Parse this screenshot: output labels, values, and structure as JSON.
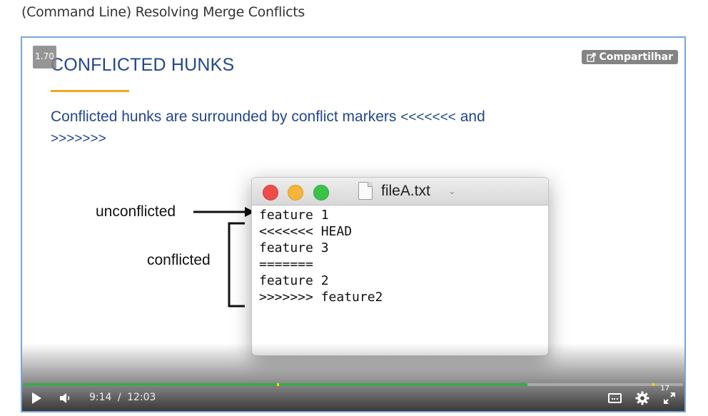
{
  "page": {
    "heading": "(Command Line) Resolving Merge Conflicts"
  },
  "player": {
    "speed": "1.70",
    "share_label": "Compartilhar",
    "current_time": "9:14",
    "time_separator": "/",
    "duration": "12:03",
    "progress_fraction": 0.764,
    "played_fraction": 0.0,
    "count_badge": "17",
    "accent_color": "#3da750",
    "chapter_marker_color": "#ffd500"
  },
  "slide": {
    "title": "CONFLICTED HUNKS",
    "text_main": "Conflicted hunks are surrounded by conflict markers ",
    "text_marker_open": "<<<<<<<",
    "text_and": " and",
    "text_marker_close": ">>>>>>>",
    "label_unconflicted": "unconflicted",
    "label_conflicted": "conflicted",
    "title_color": "#22468f",
    "underline_color": "#f0a81c"
  },
  "file_window": {
    "title": "fileA.txt",
    "lines": [
      "feature 1",
      "<<<<<<< HEAD",
      "feature 3",
      "=======",
      "feature 2",
      ">>>>>>> feature2"
    ]
  },
  "icons": {
    "play": "play-icon",
    "volume": "volume-icon",
    "captions": "captions-icon",
    "settings": "gear-icon",
    "fullscreen": "fullscreen-icon",
    "share": "share-icon"
  }
}
